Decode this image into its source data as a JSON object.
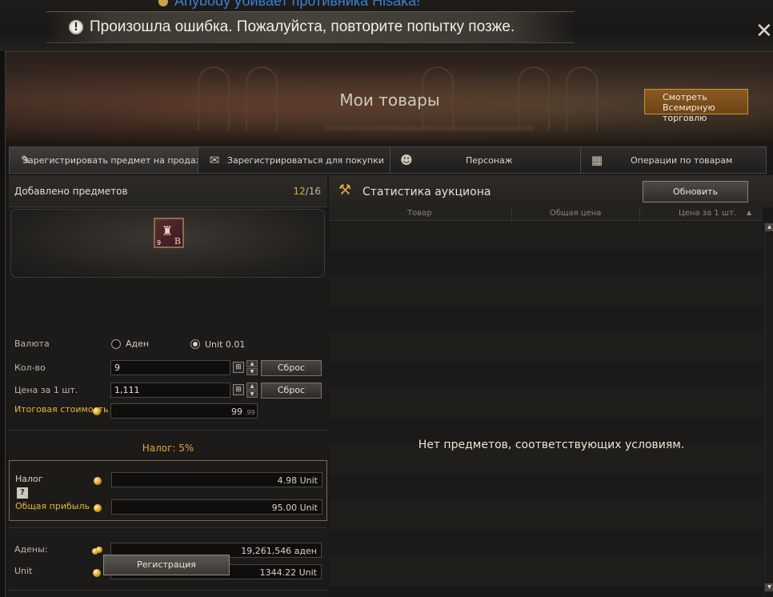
{
  "overlay": {
    "ghost_text": "Anybody убивает противника Hisaka!",
    "error_message": "Произошла ошибка. Пожалуйста, повторите попытку позже."
  },
  "header": {
    "title": "Мои товары",
    "world_trade_button": "Смотреть Всемирную торговлю"
  },
  "tabs": [
    {
      "label": "Зарегистрировать предмет на продажу",
      "icon": "scroll-quill-icon",
      "active": true
    },
    {
      "label": "Зарегистрироваться для покупки",
      "icon": "scroll-icon",
      "active": false
    },
    {
      "label": "Персонаж",
      "icon": "character-icon",
      "active": false
    },
    {
      "label": "Операции по товарам",
      "icon": "calculator-icon",
      "active": false
    }
  ],
  "left": {
    "added_label": "Добавлено предметов",
    "added_current": "12",
    "added_sep": "/",
    "added_max": "16",
    "item": {
      "qty": "9",
      "grade": "B",
      "icon": "item-bag-icon"
    },
    "currency_label": "Валюта",
    "currency_options": [
      {
        "label": "Аден",
        "selected": false
      },
      {
        "label": "Unit 0.01",
        "selected": true
      }
    ],
    "quantity_label": "Кол-во",
    "quantity_value": "9",
    "price_label": "Цена за 1 шт.",
    "price_value": "1,111",
    "reset_label": "Сброс",
    "total_label": "Итоговая стоимость",
    "total_value": "99",
    "total_cents": ".99",
    "tax_title": "Налог: 5%",
    "tax_label": "Налог",
    "tax_value": "4.98 Unit",
    "profit_label": "Общая прибыль",
    "profit_value": "95.00 Unit",
    "adena_label": "Адены:",
    "adena_value": "19,261,546 аден",
    "unit_label": "Unit",
    "unit_value": "1344.22 Unit",
    "help_label": "?",
    "register_button": "Регистрация"
  },
  "right": {
    "title": "Статистика аукциона",
    "refresh_button": "Обновить",
    "columns": [
      "Товар",
      "Общая цена",
      "Цена за 1 шт."
    ],
    "empty_message": "Нет предметов, соответствующих условиям."
  },
  "colors": {
    "accent_gold": "#e2a93b",
    "world_button": "#8a5a22"
  }
}
